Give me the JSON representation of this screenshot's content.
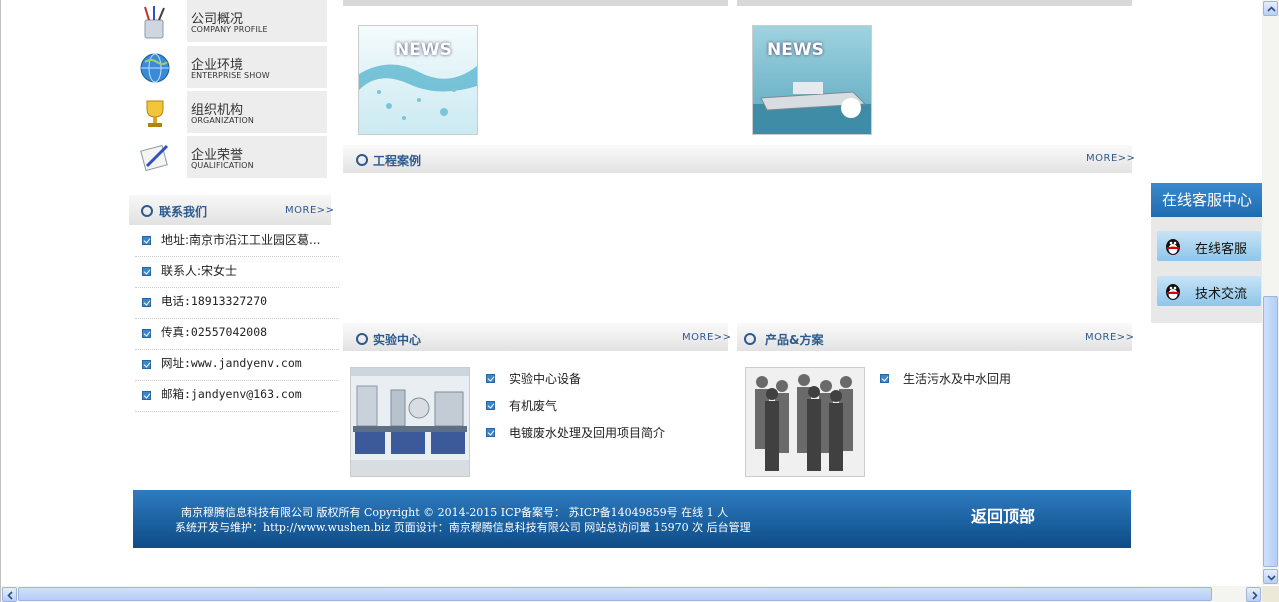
{
  "left_menu": [
    {
      "cn": "公司概况",
      "en": "COMPANY PROFILE",
      "icon": "pen-holder-icon"
    },
    {
      "cn": "企业环境",
      "en": "ENTERPRISE SHOW",
      "icon": "globe-icon"
    },
    {
      "cn": "组织机构",
      "en": "ORGANIZATION",
      "icon": "trophy-icon"
    },
    {
      "cn": "企业荣誉",
      "en": "QUALIFICATION",
      "icon": "certificate-icon"
    }
  ],
  "contact": {
    "title": "联系我们",
    "more": "MORE>>",
    "items": [
      "地址:南京市沿江工业园区葛...",
      "联系人:宋女士",
      "电话:18913327270",
      "传真:02557042008",
      "网址:www.jandyenv.com",
      "邮箱:jandyenv@163.com"
    ]
  },
  "news": {
    "word": "NEWS"
  },
  "projects": {
    "title": "工程案例",
    "more": "MORE>>"
  },
  "lab": {
    "title": "实验中心",
    "more": "MORE>>",
    "items": [
      "实验中心设备",
      "有机废气",
      "电镀废水处理及回用项目简介"
    ]
  },
  "products": {
    "title": "产品&方案",
    "more": "MORE>>",
    "items": [
      "生活污水及中水回用"
    ]
  },
  "footer": {
    "line1": "南京穆腾信息科技有限公司      版权所有      Copyright © 2014-2015      ICP备案号：  苏ICP备14049859号      在线 1 人",
    "line2": "系统开发与维护：http://www.wushen.biz      页面设计：南京穆腾信息科技有限公司      网站总访问量 15970 次      后台管理",
    "back_top": "返回顶部"
  },
  "service": {
    "title": "在线客服中心",
    "buttons": [
      "在线客服",
      "技术交流"
    ]
  },
  "colors": {
    "accent": "#2d5a8e",
    "footer": "#1a5f9e",
    "service_head": "#2a7cc4"
  }
}
